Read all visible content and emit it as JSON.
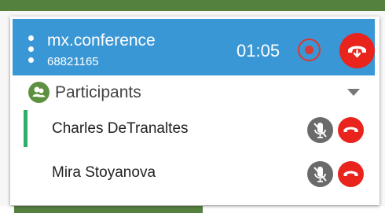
{
  "conference": {
    "name": "mx.conference",
    "number": "68821165",
    "timer": "01:05"
  },
  "participants_pane": {
    "title": "Participants"
  },
  "participants": [
    {
      "name": "Charles DeTranaltes"
    },
    {
      "name": "Mira Stoyanova"
    }
  ],
  "colors": {
    "header_blue": "#3a97d5",
    "hangup_red": "#e8241c",
    "record_red": "#d83a34",
    "mic_gray": "#6a6a6a",
    "accent_green": "#2fae68",
    "pane_icon_green": "#5e913f",
    "background_green": "#55813f"
  },
  "icons": {
    "menu": "vertical-dots-icon",
    "record": "record-icon",
    "hangup": "phone-hangup-icon",
    "participants": "participants-icon",
    "collapse": "caret-down-icon",
    "mute": "mic-muted-icon"
  }
}
